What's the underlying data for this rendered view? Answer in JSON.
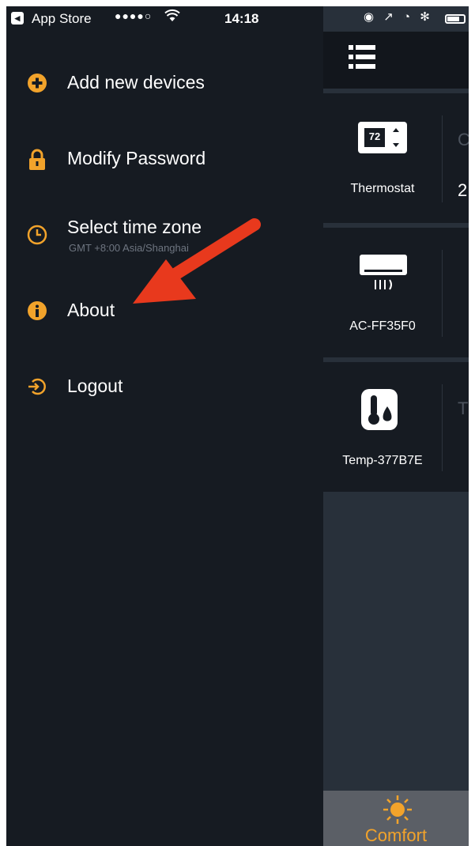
{
  "status_bar": {
    "back_glyph": "◂",
    "app_name": "App Store",
    "signal": "●●●●○",
    "wifi_glyph": "≋",
    "time": "14:18",
    "right_icons": "◉ ↗ ◔ ✻"
  },
  "menu": {
    "items": [
      {
        "label": "Add new devices",
        "icon": "plus-circle-icon"
      },
      {
        "label": "Modify Password",
        "icon": "lock-icon"
      },
      {
        "label": "Select time zone",
        "sublabel": "GMT +8:00  Asia/Shanghai",
        "icon": "clock-icon"
      },
      {
        "label": "About",
        "icon": "info-icon"
      },
      {
        "label": "Logout",
        "icon": "logout-icon"
      }
    ]
  },
  "panel": {
    "devices": [
      {
        "name": "Thermostat",
        "display_value": "72",
        "extra_top": "C",
        "extra_bottom": "2"
      },
      {
        "name": "AC-FF35F0"
      },
      {
        "name": "Temp-377B7E",
        "extra_top": "T"
      }
    ],
    "bottom_tab": {
      "label": "Comfort",
      "icon": "sun-icon"
    }
  },
  "colors": {
    "background": "#161b22",
    "accent": "#f2a32b",
    "panel": "#28303a",
    "annotation": "#e8391d"
  }
}
